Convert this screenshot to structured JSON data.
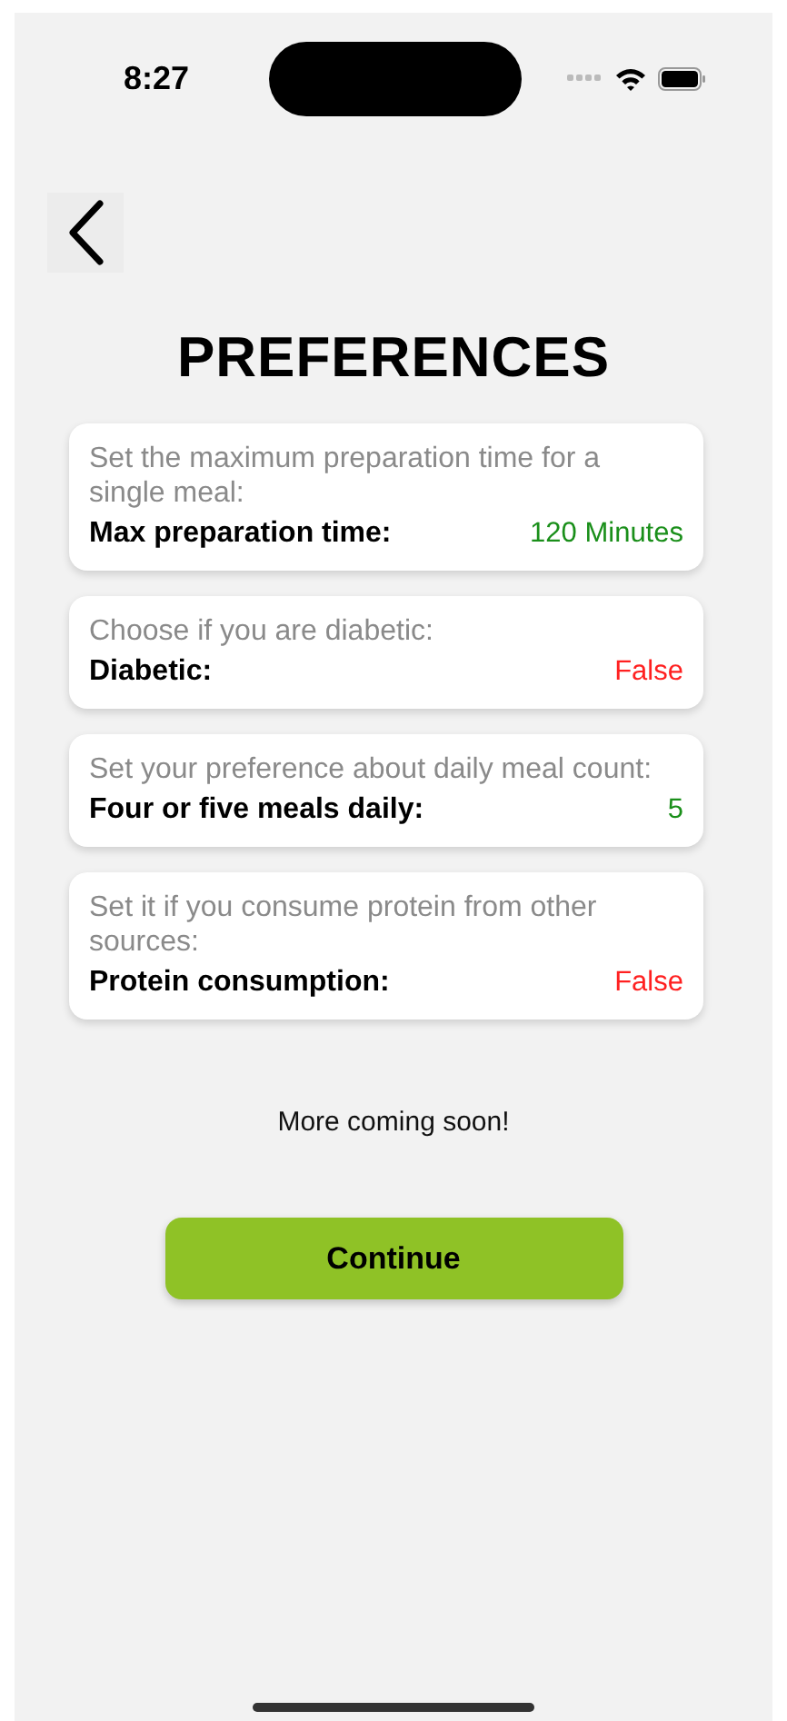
{
  "status_bar": {
    "time": "8:27"
  },
  "title": "PREFERENCES",
  "preferences": [
    {
      "description": "Set the maximum preparation time for a single meal:",
      "label": "Max preparation time:",
      "value": "120 Minutes",
      "color": "#1a8f1a"
    },
    {
      "description": "Choose if you are diabetic:",
      "label": "Diabetic:",
      "value": "False",
      "color": "#ff2020"
    },
    {
      "description": "Set your preference about daily meal count:",
      "label": "Four or five meals daily:",
      "value": "5",
      "color": "#1a8f1a"
    },
    {
      "description": "Set it if you consume protein from other sources:",
      "label": "Protein consumption:",
      "value": "False",
      "color": "#ff2020"
    }
  ],
  "note": "More coming soon!",
  "continue_button": "Continue"
}
